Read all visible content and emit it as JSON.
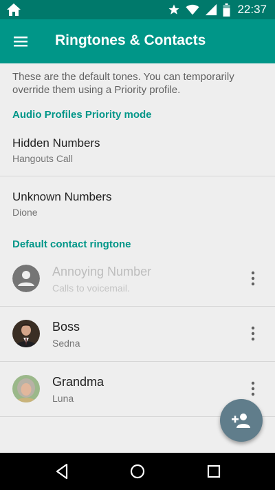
{
  "status_bar": {
    "time": "22:37",
    "icons": [
      "home-icon",
      "star-icon",
      "wifi-icon",
      "signal-icon",
      "battery-icon"
    ]
  },
  "toolbar": {
    "title": "Ringtones & Contacts",
    "menu_icon": "hamburger-menu-icon"
  },
  "intro_text": "These are the default tones. You can temporarily override them using a Priority profile.",
  "audio_section": {
    "header": "Audio Profiles Priority mode",
    "items": [
      {
        "title": "Hidden Numbers",
        "summary": "Hangouts Call"
      },
      {
        "title": "Unknown Numbers",
        "summary": "Dione"
      }
    ]
  },
  "contact_section": {
    "header": "Default contact ringtone",
    "contacts": [
      {
        "name": "Annoying Number",
        "ringtone": "Calls to voicemail.",
        "avatar": "person-placeholder",
        "enabled": false
      },
      {
        "name": "Boss",
        "ringtone": "Sedna",
        "avatar": "photo-man-suit",
        "enabled": true
      },
      {
        "name": "Grandma",
        "ringtone": "Luna",
        "avatar": "photo-woman",
        "enabled": true
      }
    ]
  },
  "fab": {
    "icon": "add-person-icon",
    "color": "#607d8b"
  },
  "nav_bar": {
    "buttons": [
      "back-icon",
      "home-icon",
      "recents-icon"
    ]
  },
  "colors": {
    "primary": "#009688",
    "primary_dark": "#00796b",
    "background": "#eeeeee"
  }
}
